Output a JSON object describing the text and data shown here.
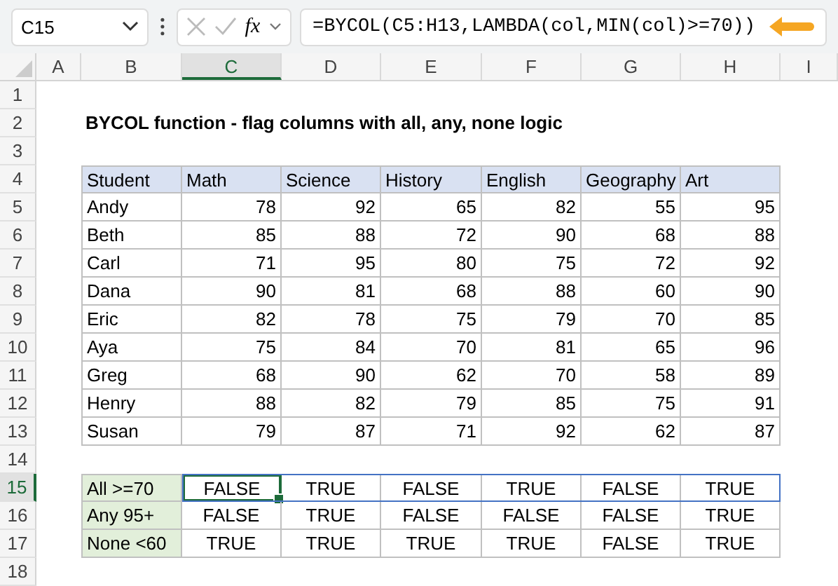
{
  "formula_bar": {
    "name_box": "C15",
    "fx_label": "fx",
    "formula": "=BYCOL(C5:H13,LAMBDA(col,MIN(col)>=70))"
  },
  "column_headers": [
    {
      "label": "A",
      "selected": false
    },
    {
      "label": "B",
      "selected": false
    },
    {
      "label": "C",
      "selected": true
    },
    {
      "label": "D",
      "selected": false
    },
    {
      "label": "E",
      "selected": false
    },
    {
      "label": "F",
      "selected": false
    },
    {
      "label": "G",
      "selected": false
    },
    {
      "label": "H",
      "selected": false
    },
    {
      "label": "I",
      "selected": false
    }
  ],
  "row_headers": [
    {
      "label": "1",
      "selected": false
    },
    {
      "label": "2",
      "selected": false
    },
    {
      "label": "3",
      "selected": false
    },
    {
      "label": "4",
      "selected": false
    },
    {
      "label": "5",
      "selected": false
    },
    {
      "label": "6",
      "selected": false
    },
    {
      "label": "7",
      "selected": false
    },
    {
      "label": "8",
      "selected": false
    },
    {
      "label": "9",
      "selected": false
    },
    {
      "label": "10",
      "selected": false
    },
    {
      "label": "11",
      "selected": false
    },
    {
      "label": "12",
      "selected": false
    },
    {
      "label": "13",
      "selected": false
    },
    {
      "label": "14",
      "selected": false
    },
    {
      "label": "15",
      "selected": true
    },
    {
      "label": "16",
      "selected": false
    },
    {
      "label": "17",
      "selected": false
    },
    {
      "label": "18",
      "selected": false
    }
  ],
  "title": "BYCOL function - flag columns with all, any, none logic",
  "table": {
    "columns": [
      "Student",
      "Math",
      "Science",
      "History",
      "English",
      "Geography",
      "Art"
    ],
    "rows": [
      [
        "Andy",
        "78",
        "92",
        "65",
        "82",
        "55",
        "95"
      ],
      [
        "Beth",
        "85",
        "88",
        "72",
        "90",
        "68",
        "88"
      ],
      [
        "Carl",
        "71",
        "95",
        "80",
        "75",
        "72",
        "92"
      ],
      [
        "Dana",
        "90",
        "81",
        "68",
        "88",
        "60",
        "90"
      ],
      [
        "Eric",
        "82",
        "78",
        "75",
        "79",
        "70",
        "85"
      ],
      [
        "Aya",
        "75",
        "84",
        "70",
        "81",
        "65",
        "96"
      ],
      [
        "Greg",
        "68",
        "90",
        "62",
        "70",
        "58",
        "89"
      ],
      [
        "Henry",
        "88",
        "82",
        "79",
        "85",
        "75",
        "91"
      ],
      [
        "Susan",
        "79",
        "87",
        "71",
        "92",
        "62",
        "87"
      ]
    ]
  },
  "results": [
    {
      "label": "All >=70",
      "spill": true,
      "values": [
        {
          "text": "FALSE",
          "selected": true
        },
        {
          "text": "TRUE",
          "selected": false
        },
        {
          "text": "FALSE",
          "selected": false
        },
        {
          "text": "TRUE",
          "selected": false
        },
        {
          "text": "FALSE",
          "selected": false
        },
        {
          "text": "TRUE",
          "selected": false
        }
      ]
    },
    {
      "label": "Any 95+",
      "spill": false,
      "values": [
        {
          "text": "FALSE",
          "selected": false
        },
        {
          "text": "TRUE",
          "selected": false
        },
        {
          "text": "FALSE",
          "selected": false
        },
        {
          "text": "FALSE",
          "selected": false
        },
        {
          "text": "FALSE",
          "selected": false
        },
        {
          "text": "TRUE",
          "selected": false
        }
      ]
    },
    {
      "label": "None <60",
      "spill": false,
      "values": [
        {
          "text": "TRUE",
          "selected": false
        },
        {
          "text": "TRUE",
          "selected": false
        },
        {
          "text": "TRUE",
          "selected": false
        },
        {
          "text": "TRUE",
          "selected": false
        },
        {
          "text": "FALSE",
          "selected": false
        },
        {
          "text": "TRUE",
          "selected": false
        }
      ]
    }
  ]
}
